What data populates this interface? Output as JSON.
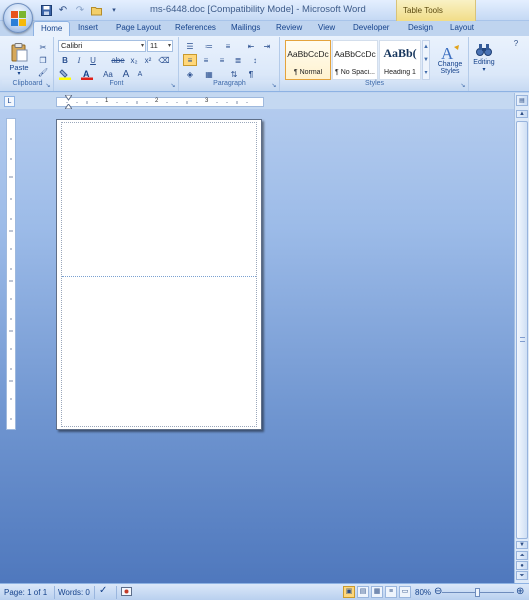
{
  "window": {
    "title": "ms-6448.doc [Compatibility Mode] - Microsoft Word",
    "contextual_tab_group": "Table Tools"
  },
  "quick_access": {
    "icons": [
      "save-icon",
      "undo-icon",
      "redo-icon",
      "open-icon",
      "customize-icon"
    ]
  },
  "tabs": [
    {
      "label": "Home",
      "active": true
    },
    {
      "label": "Insert"
    },
    {
      "label": "Page Layout"
    },
    {
      "label": "References"
    },
    {
      "label": "Mailings"
    },
    {
      "label": "Review"
    },
    {
      "label": "View"
    },
    {
      "label": "Developer"
    },
    {
      "label": "Design"
    },
    {
      "label": "Layout"
    }
  ],
  "ribbon": {
    "clipboard": {
      "label": "Clipboard",
      "paste_label": "Paste"
    },
    "font": {
      "label": "Font",
      "font_name": "Calibri",
      "font_size": "11",
      "bold": "B",
      "italic": "I",
      "underline": "U",
      "strike": "abe",
      "subscript": "x₂",
      "superscript": "x²",
      "change_case": "Aa",
      "grow": "A",
      "shrink": "A"
    },
    "paragraph": {
      "label": "Paragraph",
      "pilcrow": "¶"
    },
    "styles": {
      "label": "Styles",
      "items": [
        {
          "sample": "AaBbCcDc",
          "name": "¶ Normal",
          "selected": true
        },
        {
          "sample": "AaBbCcDc",
          "name": "¶ No Spaci..."
        },
        {
          "sample": "AaBb(",
          "name": "Heading 1"
        }
      ],
      "change_styles_line1": "Change",
      "change_styles_line2": "Styles"
    },
    "editing": {
      "label": "Editing"
    }
  },
  "ruler": {
    "tab_selector": "L",
    "numbers": [
      "1",
      "2",
      "3"
    ]
  },
  "status": {
    "page": "Page: 1 of 1",
    "words": "Words: 0",
    "zoom": "80%"
  },
  "colors": {
    "accent": "#15428b",
    "ribbon_bg": "#dbe8f9",
    "doc_background": "#6f95d0",
    "highlight": "#ffd77a"
  }
}
